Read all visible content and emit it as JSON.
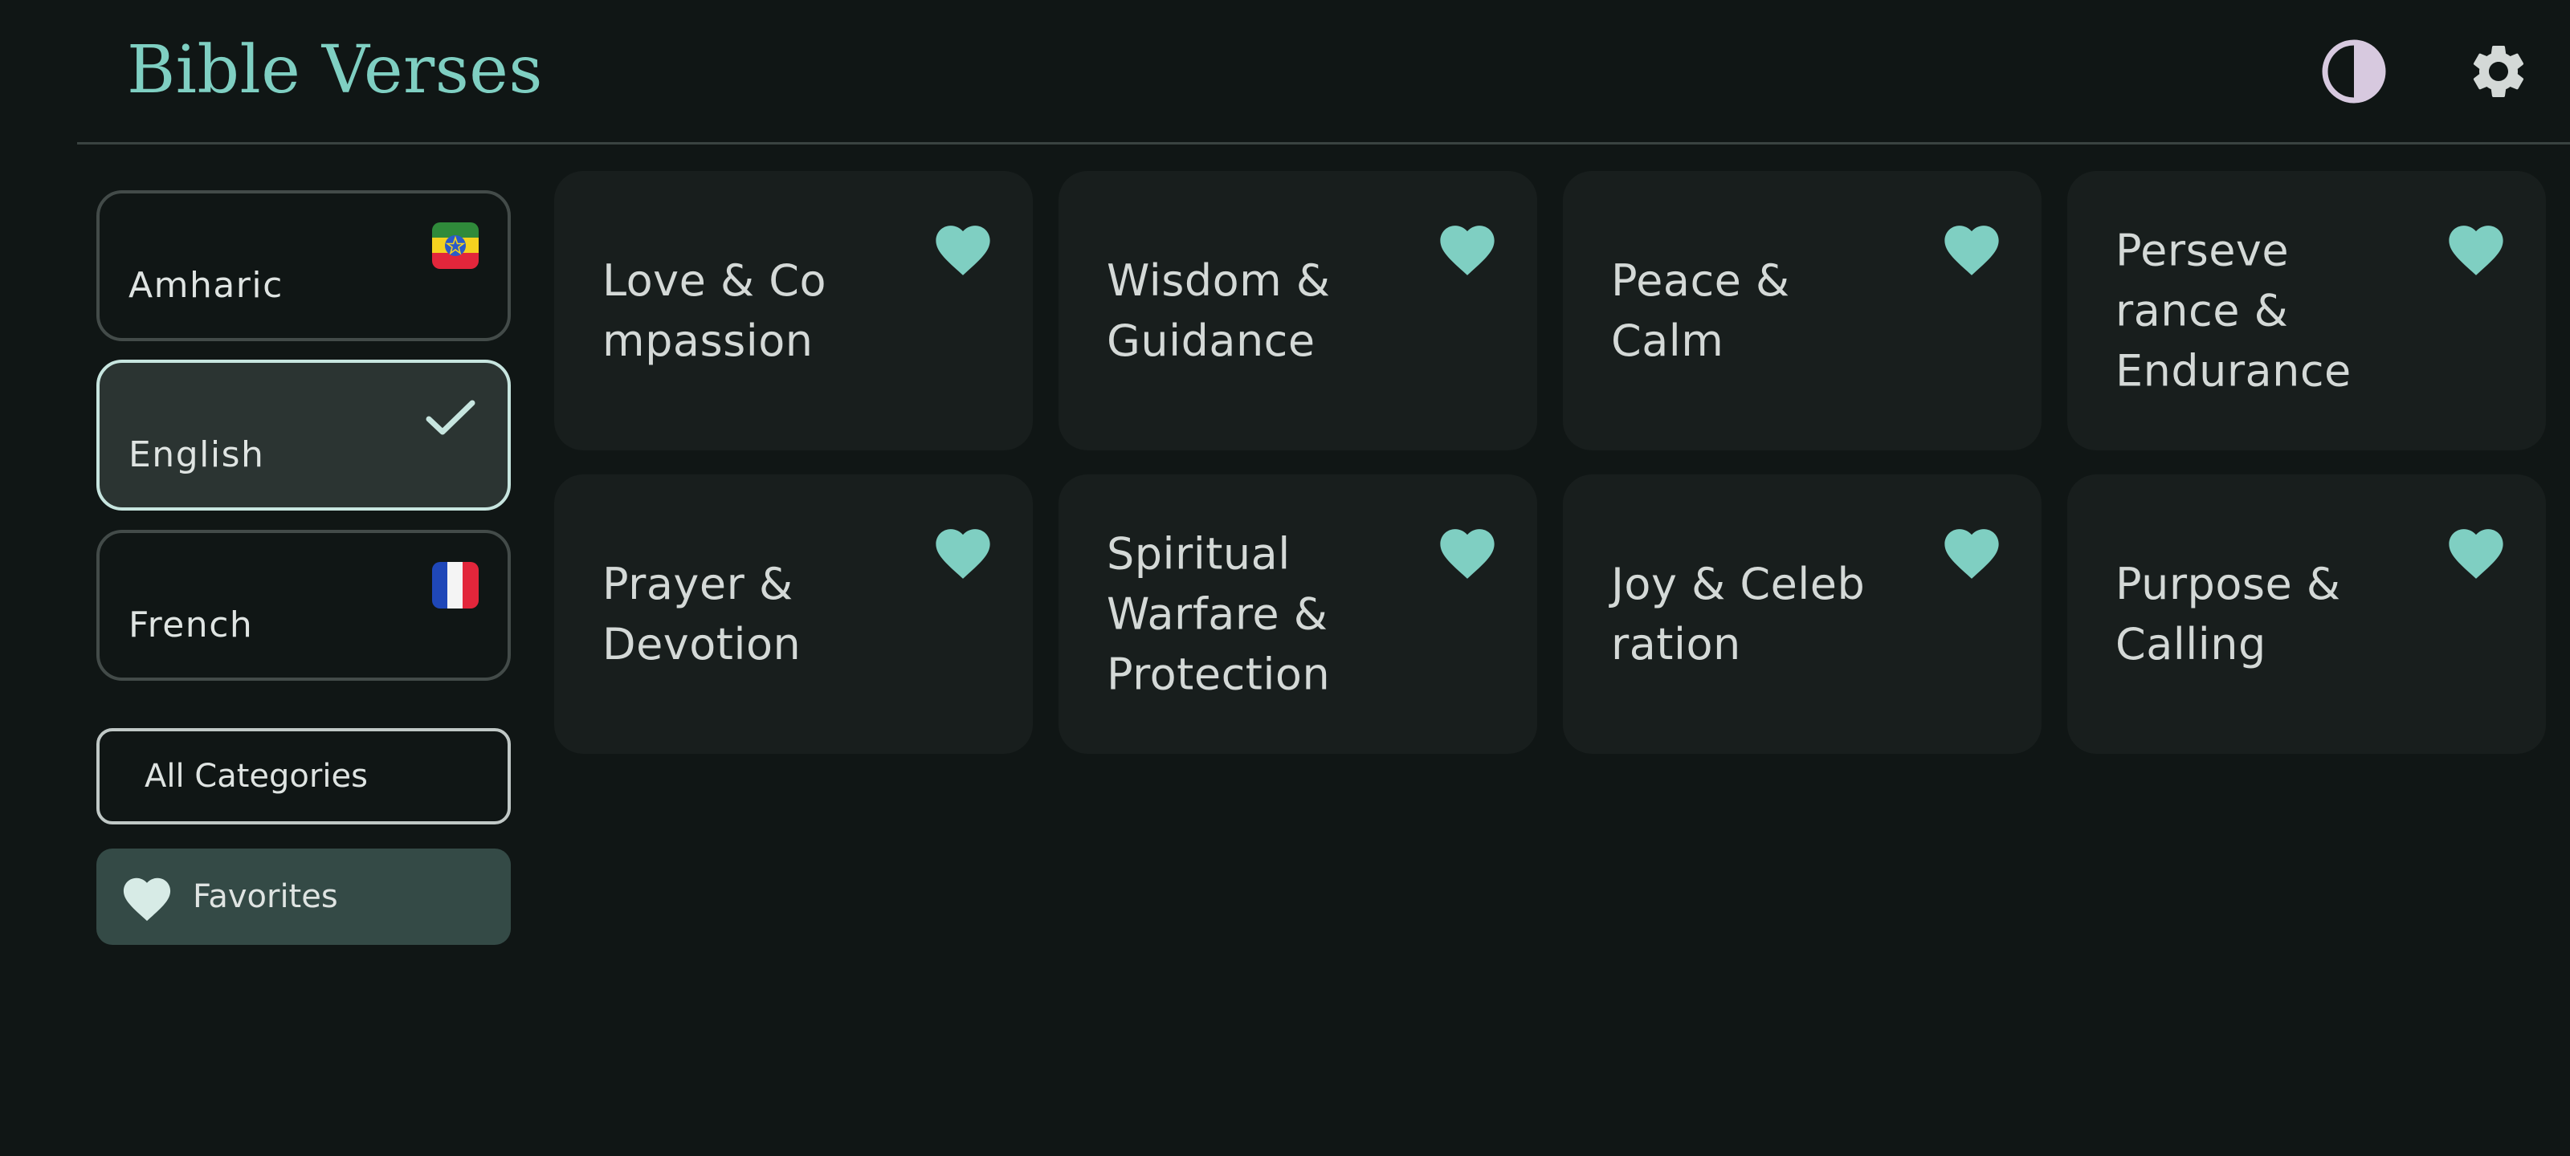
{
  "app": {
    "title": "Bible Verses"
  },
  "header": {
    "icons": [
      "contrast-icon",
      "gear-icon"
    ]
  },
  "languages": [
    {
      "label": "Amharic",
      "icon": "ethiopia-flag-icon",
      "selected": false
    },
    {
      "label": "English",
      "icon": "check-icon",
      "selected": true
    },
    {
      "label": "French",
      "icon": "france-flag-icon",
      "selected": false
    }
  ],
  "filters": {
    "all_categories": "All Categories",
    "favorites": "Favorites",
    "favorites_icon": "heart-icon"
  },
  "categories": [
    {
      "title": "Love & Co\nmpassion",
      "favorite": true
    },
    {
      "title": "Wisdom &\nGuidance",
      "favorite": true
    },
    {
      "title": "Peace &\nCalm",
      "favorite": true
    },
    {
      "title": "Perseve\nrance &\nEndurance",
      "favorite": true
    },
    {
      "title": "Prayer &\nDevotion",
      "favorite": true
    },
    {
      "title": "Spiritual\nWarfare &\nProtection",
      "favorite": true
    },
    {
      "title": "Joy & Celeb\nration",
      "favorite": true
    },
    {
      "title": "Purpose &\nCalling",
      "favorite": true
    }
  ],
  "colors": {
    "background": "#101615",
    "accent": "#7fcfc2",
    "card": "#181e1d",
    "selected_card": "#2b3432",
    "favorites_bg": "#344a46"
  }
}
